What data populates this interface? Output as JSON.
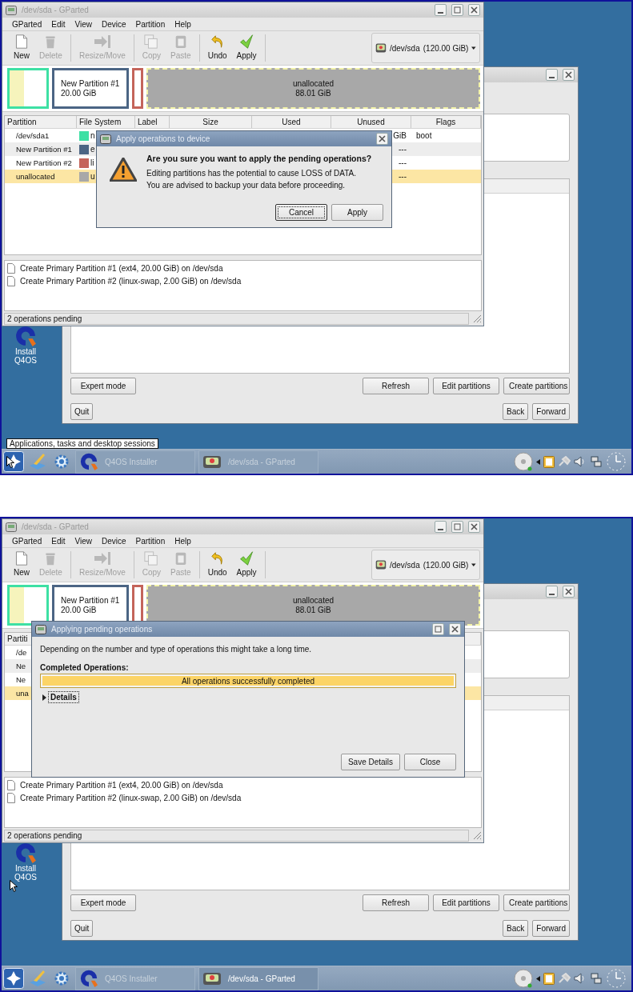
{
  "screens": [
    {
      "desktop": {
        "icon_label": "Install Q4OS"
      },
      "installer": {
        "actions": [
          "Expert mode",
          "Refresh",
          "Edit partitions",
          "Create partitions"
        ],
        "navigation": [
          "Quit",
          "Back",
          "Forward"
        ]
      },
      "gparted": {
        "title": "/dev/sda - GParted",
        "menu": [
          "GParted",
          "Edit",
          "View",
          "Device",
          "Partition",
          "Help"
        ],
        "toolbar": [
          [
            {
              "kind": "new",
              "label": "New",
              "disabled": false
            },
            {
              "kind": "delete",
              "label": "Delete",
              "disabled": true
            }
          ],
          [
            {
              "kind": "resize",
              "label": "Resize/Move",
              "disabled": true
            }
          ],
          [
            {
              "kind": "copy",
              "label": "Copy",
              "disabled": true
            },
            {
              "kind": "paste",
              "label": "Paste",
              "disabled": true
            }
          ],
          [
            {
              "kind": "undo",
              "label": "Undo",
              "disabled": false
            },
            {
              "kind": "apply",
              "label": "Apply",
              "disabled": false
            }
          ]
        ],
        "device": {
          "name": "/dev/sda",
          "size": "(120.00 GiB)"
        },
        "disk_map": [
          {
            "kind": "partition",
            "color": "#3ee0a4",
            "level": 0.4
          },
          {
            "kind": "partition",
            "color": "#4b6584",
            "name": "New Partition #1",
            "size": "20.00 GiB"
          },
          {
            "kind": "partition",
            "color": "#c4645a"
          },
          {
            "kind": "unallocated",
            "name": "unallocated",
            "size": "88.01 GiB"
          }
        ],
        "columns": [
          "Partition",
          "File System",
          "Label",
          "Size",
          "Used",
          "Unused",
          "Flags"
        ],
        "rows": [
          {
            "partition": "/dev/sda1",
            "color": "#3ee0a4",
            "file_system": "n",
            "unused": "GiB",
            "flags": "boot",
            "selected": false
          },
          {
            "partition": "New Partition #1",
            "color": "#4b6584",
            "file_system": "e",
            "unused": "---",
            "selected": false
          },
          {
            "partition": "New Partition #2",
            "color": "#c4645a",
            "file_system": "li",
            "unused": "---",
            "selected": false
          },
          {
            "partition": "unallocated",
            "color": "#a8a8a8",
            "file_system": "u",
            "unused": "---",
            "selected": true
          }
        ],
        "operations": [
          "Create Primary Partition #1 (ext4, 20.00 GiB) on /dev/sda",
          "Create Primary Partition #2 (linux-swap, 2.00 GiB) on /dev/sda"
        ],
        "status": "2 operations pending"
      },
      "dialog": {
        "kind": "confirm",
        "title": "Apply operations to device",
        "heading": "Are you sure you want to apply the pending operations?",
        "message": [
          "Editing partitions has the potential to cause LOSS of DATA.",
          "You are advised to backup your data before proceeding."
        ],
        "buttons": [
          {
            "label": "Cancel",
            "focused": true
          },
          {
            "label": "Apply",
            "focused": false
          }
        ]
      },
      "tooltip": "Applications, tasks and desktop sessions",
      "taskbar": {
        "tasks": [
          {
            "label": "Q4OS Installer",
            "active": false
          },
          {
            "label": "/dev/sda - GParted",
            "active": false
          }
        ]
      }
    },
    {
      "desktop": {
        "icon_label": "Install Q4OS"
      },
      "installer": {
        "actions": [
          "Expert mode",
          "Refresh",
          "Edit partitions",
          "Create partitions"
        ],
        "navigation": [
          "Quit",
          "Back",
          "Forward"
        ]
      },
      "gparted": {
        "title": "/dev/sda - GParted",
        "menu": [
          "GParted",
          "Edit",
          "View",
          "Device",
          "Partition",
          "Help"
        ],
        "toolbar": [
          [
            {
              "kind": "new",
              "label": "New",
              "disabled": false
            },
            {
              "kind": "delete",
              "label": "Delete",
              "disabled": true
            }
          ],
          [
            {
              "kind": "resize",
              "label": "Resize/Move",
              "disabled": true
            }
          ],
          [
            {
              "kind": "copy",
              "label": "Copy",
              "disabled": true
            },
            {
              "kind": "paste",
              "label": "Paste",
              "disabled": true
            }
          ],
          [
            {
              "kind": "undo",
              "label": "Undo",
              "disabled": false
            },
            {
              "kind": "apply",
              "label": "Apply",
              "disabled": false
            }
          ]
        ],
        "device": {
          "name": "/dev/sda",
          "size": "(120.00 GiB)"
        },
        "disk_map": [
          {
            "kind": "partition",
            "color": "#3ee0a4",
            "level": 0.4
          },
          {
            "kind": "partition",
            "color": "#4b6584",
            "name": "New Partition #1",
            "size": "20.00 GiB"
          },
          {
            "kind": "partition",
            "color": "#c4645a"
          },
          {
            "kind": "unallocated",
            "name": "unallocated",
            "size": "88.01 GiB"
          }
        ],
        "columns": [
          "Partiti"
        ],
        "rows": [
          {
            "partition": "/de",
            "selected": false
          },
          {
            "partition": "Ne",
            "selected": false
          },
          {
            "partition": "Ne",
            "selected": false
          },
          {
            "partition": "una",
            "selected": true
          }
        ],
        "operations": [
          "Create Primary Partition #1 (ext4, 20.00 GiB) on /dev/sda",
          "Create Primary Partition #2 (linux-swap, 2.00 GiB) on /dev/sda"
        ],
        "status": "2 operations pending"
      },
      "dialog": {
        "kind": "progress",
        "title": "Applying pending operations",
        "message": "Depending on the number and type of operations this might take a long time.",
        "section": "Completed Operations:",
        "progress": {
          "text": "All operations successfully completed",
          "level": 1
        },
        "expander": {
          "label": "Details",
          "expanded": false
        },
        "buttons": [
          {
            "label": "Save Details",
            "focused": false
          },
          {
            "label": "Close",
            "focused": false
          }
        ]
      },
      "taskbar": {
        "tasks": [
          {
            "label": "Q4OS Installer",
            "active": false
          },
          {
            "label": "/dev/sda - GParted",
            "active": true
          }
        ]
      }
    }
  ]
}
